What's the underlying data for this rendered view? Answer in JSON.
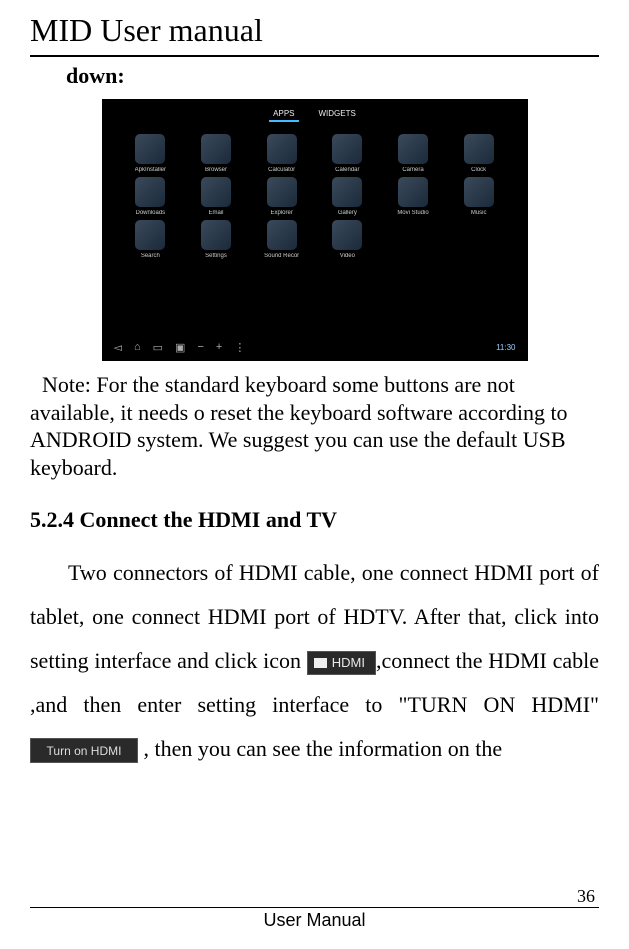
{
  "doc": {
    "title": "MID User manual",
    "down_label": "down:",
    "note": "Note: For the standard keyboard some buttons are not available, it needs o reset the keyboard software according to ANDROID system. We suggest you can use the default USB keyboard.",
    "section": "5.2.4 Connect the HDMI and TV",
    "body_pre": "Two connectors of HDMI cable, one connect HDMI port of tablet, one connect HDMI port of HDTV. After that, click into setting interface and click icon",
    "hdmi_btn": "HDMI",
    "body_mid": ",connect the HDMI cable ,and then enter setting interface to \"TURN ON HDMI\" ",
    "turn_on_btn": "Turn on HDMI",
    "body_post": " , then you can see the information on the",
    "page_num": "36",
    "footer": "User Manual"
  },
  "screenshot": {
    "tabs": {
      "apps": "APPS",
      "widgets": "WIDGETS"
    },
    "apps": [
      "ApkInstaller",
      "Browser",
      "Calculator",
      "Calendar",
      "Camera",
      "Clock",
      "Downloads",
      "Email",
      "Explorer",
      "Gallery",
      "Movi Studio",
      "Music",
      "Search",
      "Settings",
      "Sound Recor",
      "Video"
    ],
    "clock": "11:30"
  }
}
